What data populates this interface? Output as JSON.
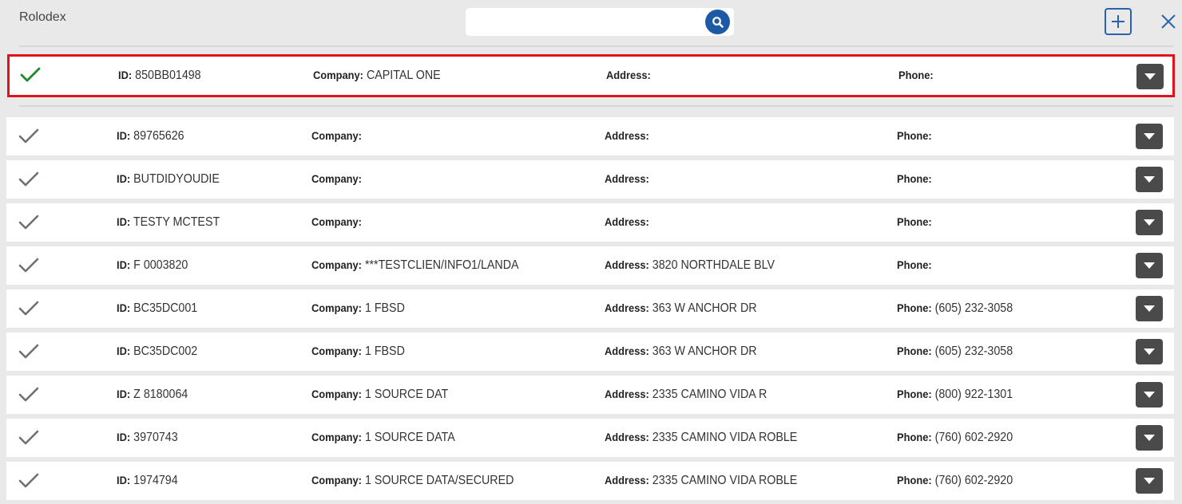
{
  "header": {
    "title": "Rolodex",
    "search_value": "",
    "search_placeholder": ""
  },
  "labels": {
    "id": "ID:",
    "company": "Company:",
    "address": "Address:",
    "phone": "Phone:"
  },
  "colors": {
    "accent": "#1c5aa6",
    "selected_border": "#e0121a",
    "check_selected": "#1e8a2e",
    "check_default": "#707070"
  },
  "selected_row": {
    "id": "850BB01498",
    "company": "CAPITAL ONE",
    "address": "",
    "phone": ""
  },
  "rows": [
    {
      "id": "89765626",
      "company": "",
      "address": "",
      "phone": ""
    },
    {
      "id": "BUTDIDYOUDIE",
      "company": "",
      "address": "",
      "phone": ""
    },
    {
      "id": "TESTY MCTEST",
      "company": "",
      "address": "",
      "phone": ""
    },
    {
      "id": "F 0003820",
      "company": "***TESTCLIEN/INFO1/LANDA",
      "address": "3820 NORTHDALE BLV",
      "phone": ""
    },
    {
      "id": "BC35DC001",
      "company": "1 FBSD",
      "address": "363 W ANCHOR DR",
      "phone": "(605) 232-3058"
    },
    {
      "id": "BC35DC002",
      "company": "1 FBSD",
      "address": "363 W ANCHOR DR",
      "phone": "(605) 232-3058"
    },
    {
      "id": "Z 8180064",
      "company": "1 SOURCE DAT",
      "address": "2335 CAMINO VIDA R",
      "phone": "(800) 922-1301"
    },
    {
      "id": "3970743",
      "company": "1 SOURCE DATA",
      "address": "2335 CAMINO VIDA ROBLE",
      "phone": "(760) 602-2920"
    },
    {
      "id": "1974794",
      "company": "1 SOURCE DATA/SECURED",
      "address": "2335 CAMINO VIDA ROBLE",
      "phone": "(760) 602-2920"
    }
  ]
}
